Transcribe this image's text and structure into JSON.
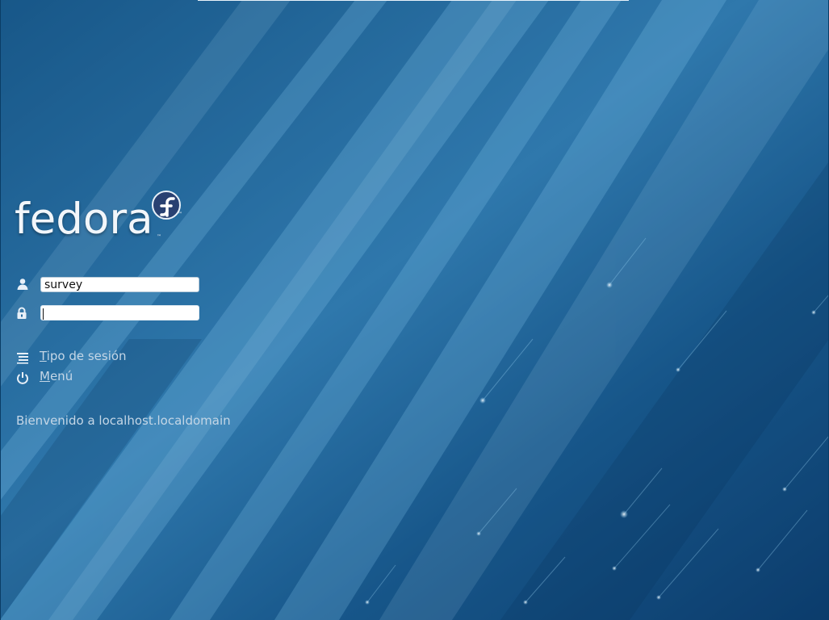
{
  "login": {
    "username_value": "survey",
    "password_value": ""
  },
  "logo": {
    "text": "fedora",
    "tm": "™"
  },
  "links": {
    "session_type": {
      "mnemonic": "T",
      "rest": "ipo de sesión"
    },
    "menu": {
      "mnemonic": "M",
      "rest": "enú"
    }
  },
  "welcome_text": "Bienvenido a localhost.localdomain",
  "icons": {
    "user": "user-icon",
    "password": "lock-icon",
    "session": "list-icon",
    "menu": "power-icon"
  },
  "colors": {
    "background_dark": "#0c4a7c",
    "background_light": "#4fa9dc",
    "link_text": "#c4d6e6",
    "logo_blue": "#294172"
  }
}
